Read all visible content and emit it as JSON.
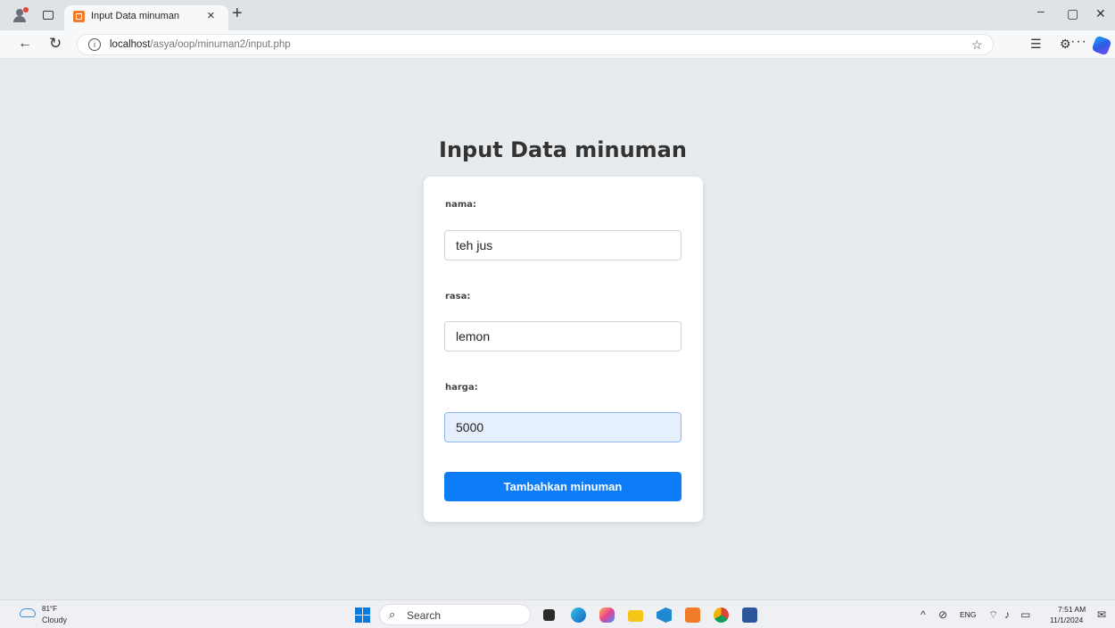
{
  "browser": {
    "tab_title": "Input Data minuman",
    "tab_close": "×",
    "new_tab": "+",
    "url_host": "localhost",
    "url_path": "/asya/oop/minuman2/input.php",
    "window_controls": {
      "minimize": "–",
      "maximize": "▢",
      "close": "✕"
    }
  },
  "page": {
    "title": "Input Data minuman",
    "form": {
      "fields": [
        {
          "label": "nama:",
          "value": "teh jus"
        },
        {
          "label": "rasa:",
          "value": "lemon"
        },
        {
          "label": "harga:",
          "value": "5000"
        }
      ],
      "submit_label": "Tambahkan minuman"
    }
  },
  "taskbar": {
    "weather": {
      "temp": "81°F",
      "condition": "Cloudy"
    },
    "search_placeholder": "Search",
    "apps": [
      "file-explorer-dark",
      "edge",
      "copilot",
      "file-explorer",
      "vscode",
      "xampp",
      "chrome",
      "word"
    ],
    "tray": {
      "language": "ENG",
      "time": "7:51 AM",
      "date": "11/1/2024"
    }
  },
  "colors": {
    "accent": "#0d7df7",
    "page_bg": "#e8ebee",
    "focus_bg": "#e6f0fd"
  }
}
